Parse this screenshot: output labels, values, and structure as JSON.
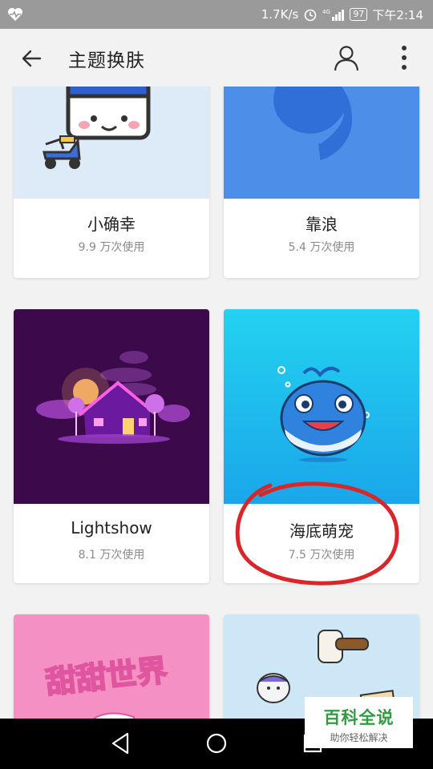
{
  "status_bar": {
    "speed": "1.7K/s",
    "battery": "97",
    "time": "下午2:14"
  },
  "app_bar": {
    "title": "主题换肤",
    "back_icon": "arrow-left-icon",
    "profile_icon": "person-icon",
    "more_icon": "more-vert-icon"
  },
  "themes": [
    {
      "name": "小确幸",
      "usage": "9.9 万次使用"
    },
    {
      "name": "靠浪",
      "usage": "5.4 万次使用"
    },
    {
      "name": "Lightshow",
      "usage": "8.1 万次使用"
    },
    {
      "name": "海底萌宠",
      "usage": "7.5 万次使用"
    },
    {
      "thumb_text": "甜甜世界"
    },
    {
      "name": ""
    }
  ],
  "nav": {
    "back_icon": "triangle-back-icon",
    "home_icon": "circle-home-icon",
    "recents_icon": "square-recents-icon"
  },
  "watermark": {
    "title": "百科全说",
    "subtitle": "助你轻松解决"
  },
  "colors": {
    "annotation_red": "#d9262a",
    "status_bar": "#9a9a9a"
  }
}
